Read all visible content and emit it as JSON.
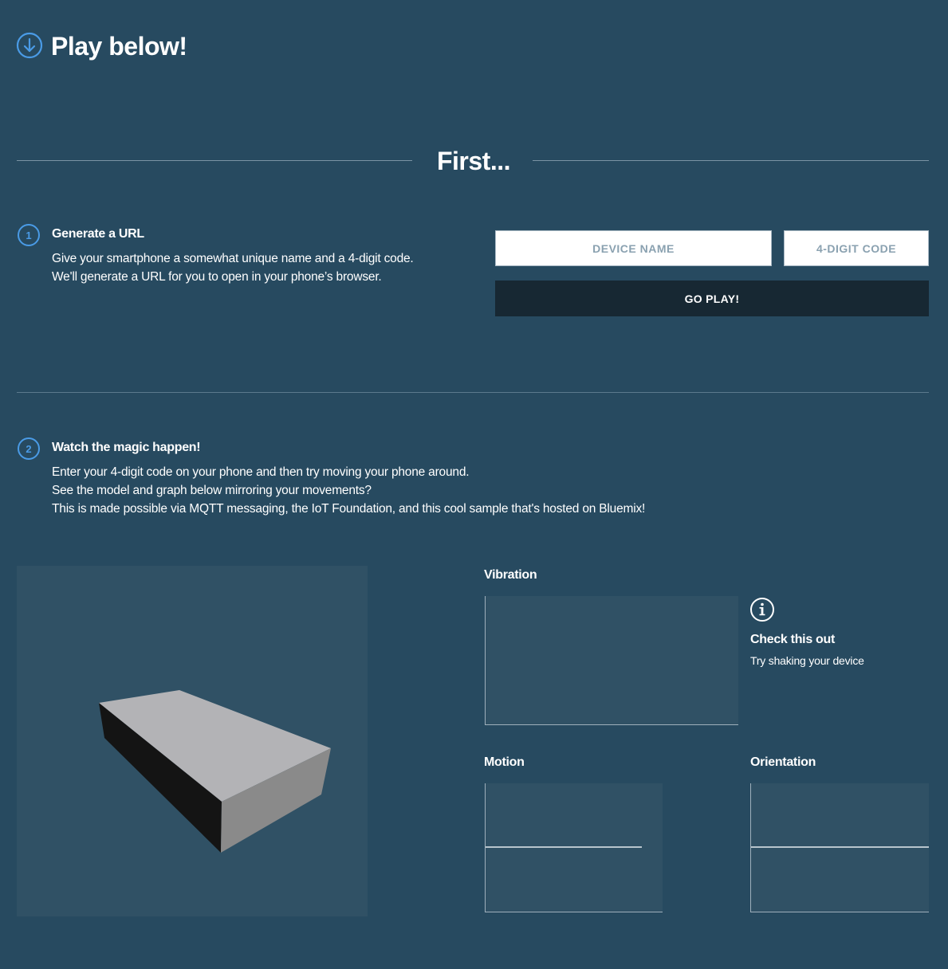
{
  "header": {
    "title": "Play below!",
    "icon": "arrow-down-circle-icon"
  },
  "first_section": {
    "title": "First..."
  },
  "step1": {
    "number": "1",
    "heading": "Generate a URL",
    "line1": "Give your smartphone a somewhat unique name and a 4-digit code.",
    "line2": "We'll generate a URL for you to open in your phone’s browser."
  },
  "form": {
    "device_name_placeholder": "DEVICE NAME",
    "code_placeholder": "4-DIGIT CODE",
    "device_name_value": "",
    "code_value": "",
    "submit_label": "GO PLAY!"
  },
  "step2": {
    "number": "2",
    "heading": "Watch the magic happen!",
    "line1": "Enter your 4-digit code on your phone and then try moving your phone around.",
    "line2": "See the model and graph below mirroring your movements?",
    "line3": "This is made possible via MQTT messaging, the IoT Foundation, and this cool sample that's hosted on Bluemix!"
  },
  "charts": {
    "vibration_label": "Vibration",
    "motion_label": "Motion",
    "orientation_label": "Orientation"
  },
  "info": {
    "icon": "info-circle-icon",
    "heading": "Check this out",
    "text": "Try shaking your device"
  },
  "colors": {
    "background": "#274a60",
    "panel": "#305165",
    "accent": "#4a9be6",
    "button": "#172833"
  }
}
